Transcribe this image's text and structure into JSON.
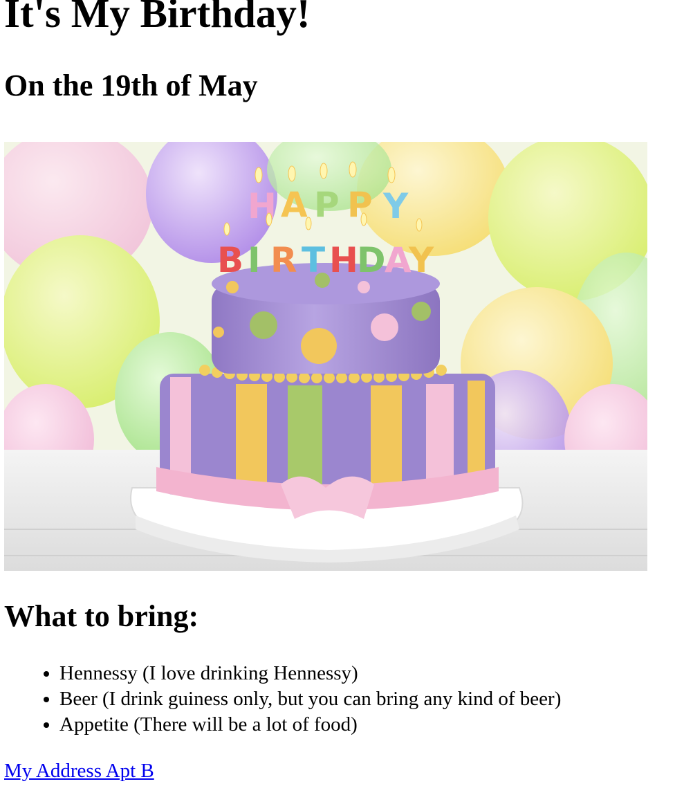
{
  "heading": "It's My Birthday!",
  "subheading": "On the 19th of May",
  "image": {
    "icon": "birthday-cake-photo",
    "cake_letters": [
      "H",
      "A",
      "P",
      "P",
      "Y",
      "B",
      "I",
      "R",
      "T",
      "H",
      "D",
      "A",
      "Y"
    ],
    "colors": {
      "cake_top": "#a993d6",
      "cake_bottom": "#9b86cf",
      "ribbon": "#f3b4cf",
      "stripe_yellow": "#f2c75c",
      "stripe_green": "#a8c96a",
      "stripe_pink": "#f4c1d9"
    }
  },
  "bring": {
    "title": "What to bring:",
    "items": [
      "Hennessy (I love drinking Hennessy)",
      "Beer (I drink guiness only, but you can bring any kind of beer)",
      "Appetite (There will be a lot of food)"
    ]
  },
  "link": {
    "label": "My Address Apt B"
  },
  "colors": {
    "text": "#000000",
    "link": "#0000ee",
    "background": "#ffffff"
  }
}
